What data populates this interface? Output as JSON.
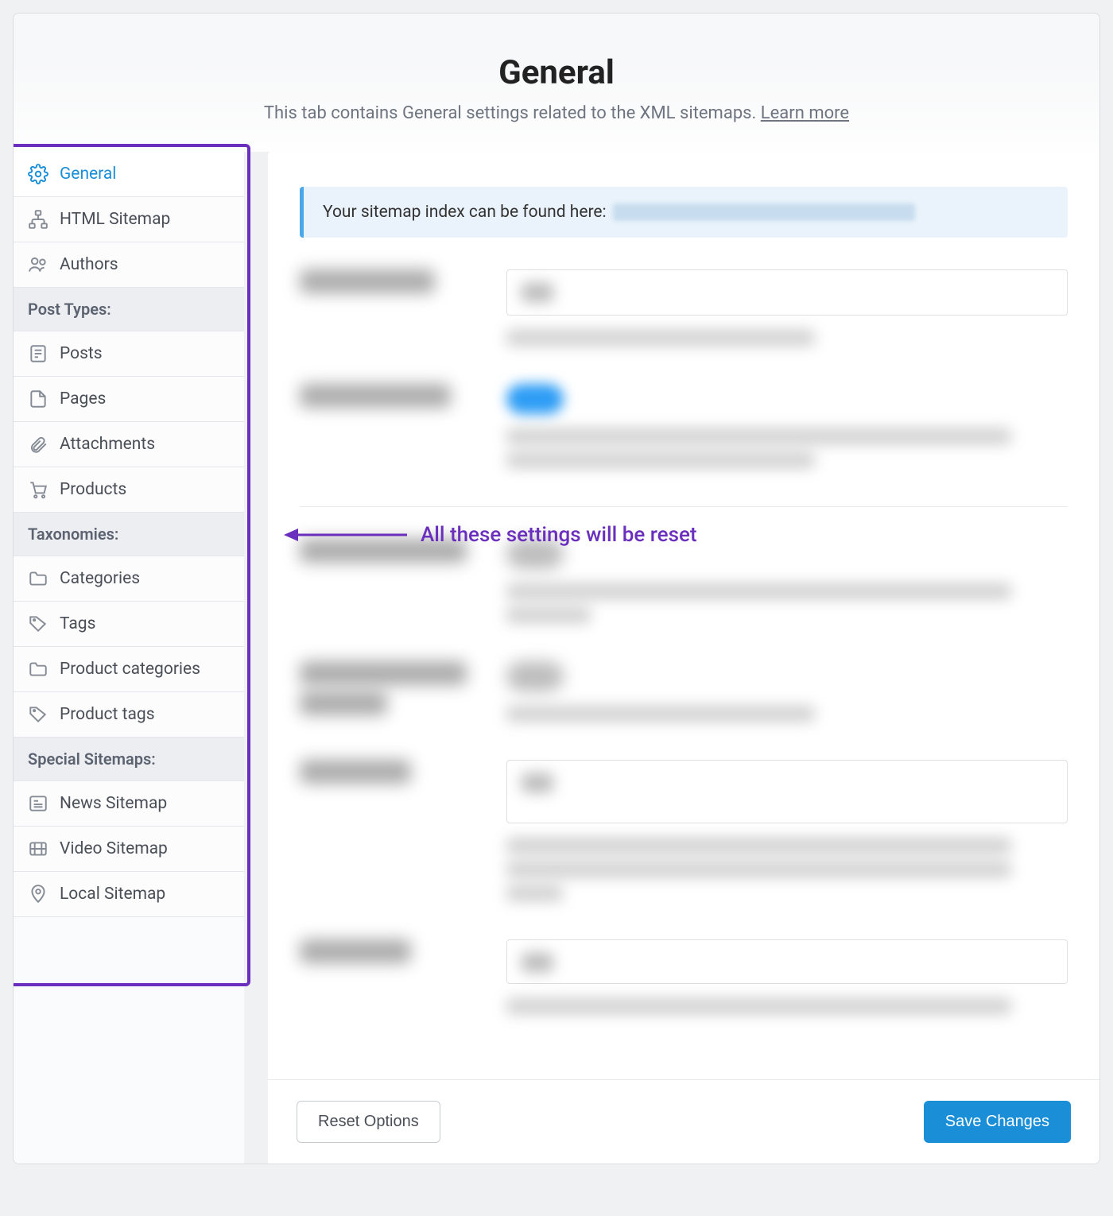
{
  "header": {
    "title": "General",
    "subtitle_prefix": "This tab contains General settings related to the XML sitemaps. ",
    "learn_more": "Learn more"
  },
  "sidebar": {
    "items_top": [
      {
        "label": "General",
        "icon": "gear-icon",
        "active": true
      },
      {
        "label": "HTML Sitemap",
        "icon": "sitemap-icon"
      },
      {
        "label": "Authors",
        "icon": "people-icon"
      }
    ],
    "group_post_types": "Post Types:",
    "items_post": [
      {
        "label": "Posts",
        "icon": "post-icon"
      },
      {
        "label": "Pages",
        "icon": "page-icon"
      },
      {
        "label": "Attachments",
        "icon": "paperclip-icon"
      },
      {
        "label": "Products",
        "icon": "cart-icon"
      }
    ],
    "group_taxonomies": "Taxonomies:",
    "items_tax": [
      {
        "label": "Categories",
        "icon": "folder-icon"
      },
      {
        "label": "Tags",
        "icon": "tag-icon"
      },
      {
        "label": "Product categories",
        "icon": "folder-icon"
      },
      {
        "label": "Product tags",
        "icon": "tag-icon"
      }
    ],
    "group_special": "Special Sitemaps:",
    "items_special": [
      {
        "label": "News Sitemap",
        "icon": "news-icon"
      },
      {
        "label": "Video Sitemap",
        "icon": "video-icon"
      },
      {
        "label": "Local Sitemap",
        "icon": "location-icon"
      }
    ]
  },
  "notice": {
    "text": "Your sitemap index can be found here: "
  },
  "annotation": {
    "text": "All these settings will be reset"
  },
  "footer": {
    "reset": "Reset Options",
    "save": "Save Changes"
  }
}
